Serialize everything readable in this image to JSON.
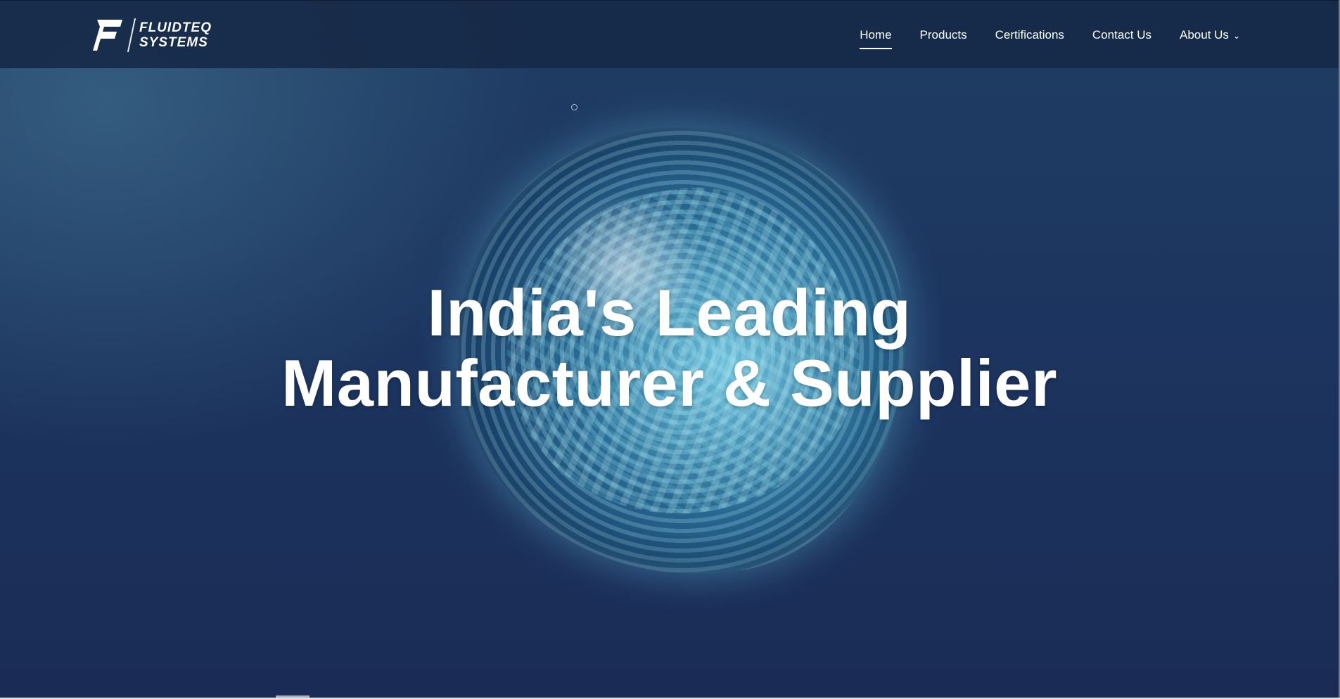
{
  "brand": {
    "line1": "FLUIDTEQ",
    "line2": "SYSTEMS",
    "mark_letter": "F"
  },
  "nav": {
    "items": [
      {
        "label": "Home",
        "active": true
      },
      {
        "label": "Products",
        "active": false
      },
      {
        "label": "Certifications",
        "active": false
      },
      {
        "label": "Contact Us",
        "active": false
      },
      {
        "label": "About Us",
        "active": false,
        "has_dropdown": true
      }
    ],
    "dropdown_icon": "chevron-down-icon"
  },
  "hero": {
    "headline_line1": "India's Leading",
    "headline_line2": "Manufacturer & Supplier",
    "background_icon": "water-blob"
  },
  "colors": {
    "header_bg": "#162845",
    "hero_top": "#1f3d63",
    "hero_bottom": "#1a2c55",
    "text": "#ffffff",
    "accent_cyan": "#8cebff"
  }
}
